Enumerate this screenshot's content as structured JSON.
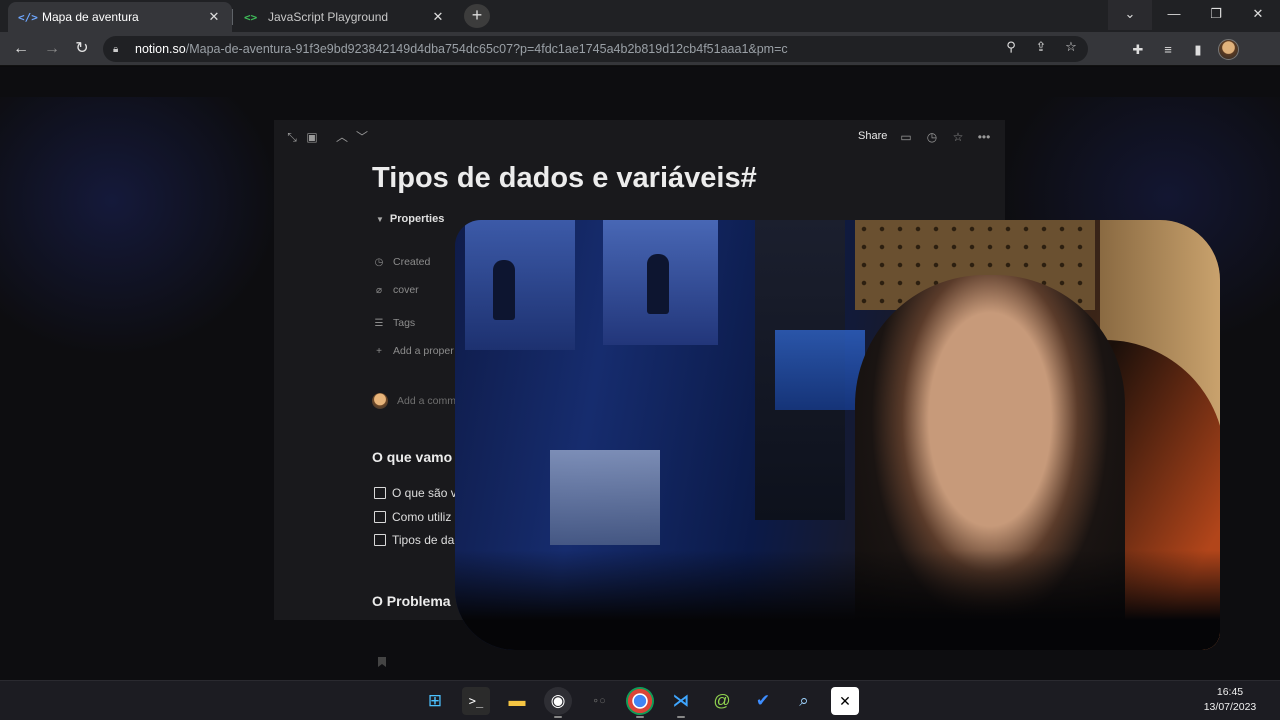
{
  "browser": {
    "tabs": [
      {
        "title": "Mapa de aventura",
        "icon": "code-brackets-icon",
        "active": true
      },
      {
        "title": "JavaScript Playground",
        "icon": "js-playground-icon",
        "active": false
      }
    ],
    "url_host": "notion.so",
    "url_path": "/Mapa-de-aventura-91f3e9bd923842149d4dba754dc65c07?p=4fdc1ae1745a4b2b819d12cb4f51aaa1&pm=c"
  },
  "notion": {
    "share_label": "Share",
    "title": "Tipos de dados e variáveis#",
    "properties_label": "Properties",
    "properties": [
      {
        "icon": "clock-icon",
        "label": "Created"
      },
      {
        "icon": "paperclip-icon",
        "label": "cover"
      },
      {
        "icon": "list-icon",
        "label": "Tags"
      },
      {
        "icon": "plus-icon",
        "label": "Add a proper"
      }
    ],
    "comment_placeholder": "Add a comm",
    "section1_heading": "O que vamo",
    "checklist": [
      "O que são v",
      "Como utiliz",
      "Tipos de da"
    ],
    "section2_heading": "O Problema"
  },
  "taskbar": {
    "apps": [
      "windows-start-icon",
      "terminal-icon",
      "file-explorer-icon",
      "obs-icon",
      "chrome-icon",
      "vscode-icon",
      "app-swirl-icon",
      "todo-icon",
      "magnifier-icon",
      "capcut-icon"
    ],
    "time": "16:45",
    "date": "13/07/2023"
  }
}
